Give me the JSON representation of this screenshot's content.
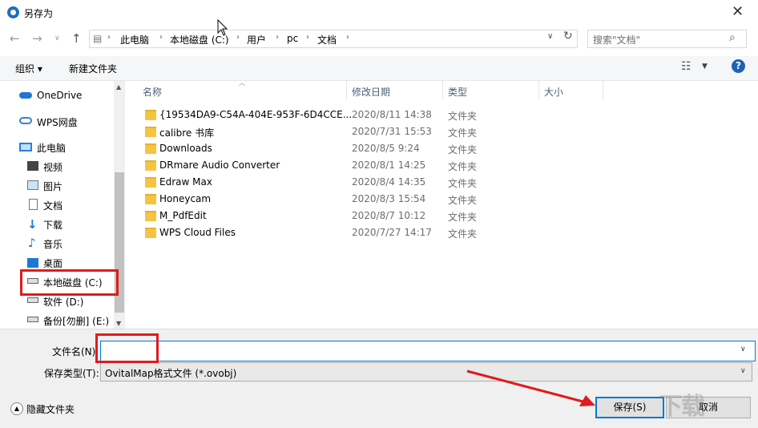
{
  "window": {
    "title": "另存为"
  },
  "address": {
    "crumbs": [
      "此电脑",
      "本地磁盘 (C:)",
      "用户",
      "pc",
      "文档"
    ],
    "search_placeholder": "搜索\"文档\""
  },
  "toolbar": {
    "organize": "组织 ▾",
    "new_folder": "新建文件夹",
    "help": "?"
  },
  "navpane": {
    "items": [
      {
        "label": "OneDrive",
        "icon": "cloud-icon"
      },
      {
        "label": "WPS网盘",
        "icon": "wps-cloud-icon"
      },
      {
        "label": "此电脑",
        "icon": "computer-icon"
      },
      {
        "label": "视频",
        "icon": "video-icon"
      },
      {
        "label": "图片",
        "icon": "picture-icon"
      },
      {
        "label": "文档",
        "icon": "document-icon"
      },
      {
        "label": "下载",
        "icon": "download-icon"
      },
      {
        "label": "音乐",
        "icon": "music-icon"
      },
      {
        "label": "桌面",
        "icon": "desktop-icon"
      },
      {
        "label": "本地磁盘 (C:)",
        "icon": "drive-icon"
      },
      {
        "label": "软件 (D:)",
        "icon": "drive-icon"
      },
      {
        "label": "备份[勿删] (E:)",
        "icon": "drive-icon"
      }
    ]
  },
  "columns": {
    "name": "名称",
    "date": "修改日期",
    "type": "类型",
    "size": "大小"
  },
  "files": [
    {
      "name": "{19534DA9-C54A-404E-953F-6D4CCE...",
      "date": "2020/8/11 14:38",
      "type": "文件夹"
    },
    {
      "name": "calibre 书库",
      "date": "2020/7/31 15:53",
      "type": "文件夹"
    },
    {
      "name": "Downloads",
      "date": "2020/8/5 9:24",
      "type": "文件夹"
    },
    {
      "name": "DRmare Audio Converter",
      "date": "2020/8/1 14:25",
      "type": "文件夹"
    },
    {
      "name": "Edraw Max",
      "date": "2020/8/4 14:35",
      "type": "文件夹"
    },
    {
      "name": "Honeycam",
      "date": "2020/8/3 15:54",
      "type": "文件夹"
    },
    {
      "name": "M_PdfEdit",
      "date": "2020/8/7 10:12",
      "type": "文件夹"
    },
    {
      "name": "WPS Cloud Files",
      "date": "2020/7/27 14:17",
      "type": "文件夹"
    }
  ],
  "filename": {
    "label": "文件名(N):",
    "value": ""
  },
  "filetype": {
    "label": "保存类型(T):",
    "value": "OvitalMap格式文件 (*.ovobj)"
  },
  "footer": {
    "hide_folders": "隐藏文件夹",
    "save": "保存(S)",
    "cancel": "取消"
  },
  "watermark": "下载"
}
